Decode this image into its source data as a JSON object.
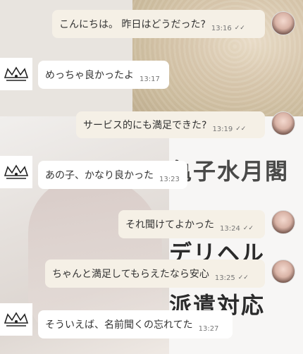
{
  "messages": [
    {
      "text": "こんにちは。 昨日はどうだった?",
      "time": "13:16",
      "side": "out"
    },
    {
      "text": "めっちゃ良かったよ",
      "time": "13:17",
      "side": "in"
    },
    {
      "text": "サービス的にも満足できた?",
      "time": "13:19",
      "side": "out"
    },
    {
      "text": "あの子、かなり良かった",
      "time": "13:23",
      "side": "in"
    },
    {
      "text": "それ聞けてよかった",
      "time": "13:24",
      "side": "out"
    },
    {
      "text": "ちゃんと満足してもらえたなら安心",
      "time": "13:25",
      "side": "out"
    },
    {
      "text": "そういえば、名前聞くの忘れてた",
      "time": "13:27",
      "side": "in"
    }
  ],
  "background_text": {
    "line1": "亀子水月閣",
    "line2": "デリヘル",
    "line3": "派遣対応"
  },
  "icons": {
    "read_receipt": "double-check-icon",
    "contact_avatar": "contact-avatar",
    "bot_avatar": "crown-doodle-icon"
  },
  "colors": {
    "outgoing_bubble": "#f5f0e6",
    "incoming_bubble": "#ffffff"
  }
}
